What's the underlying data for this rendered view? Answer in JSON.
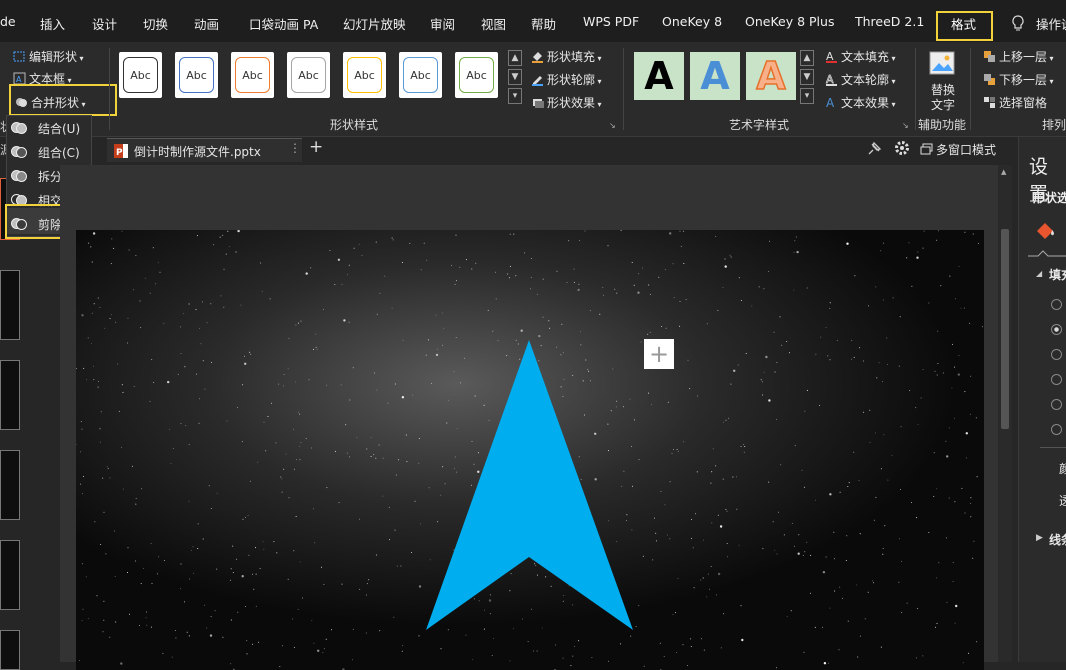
{
  "menu": {
    "items": [
      "de",
      "插入",
      "设计",
      "切换",
      "动画",
      "口袋动画 PA",
      "幻灯片放映",
      "审阅",
      "视图",
      "帮助",
      "WPS PDF",
      "OneKey 8",
      "OneKey 8 Plus",
      "ThreeD 2.1",
      "格式",
      "操作说"
    ]
  },
  "ribbon": {
    "edit_shape": "编辑形状",
    "text_box": "文本框",
    "merge_shapes": "合并形状",
    "style_label": "Abc",
    "shape_fill": "形状填充",
    "shape_outline": "形状轮廓",
    "shape_effect": "形状效果",
    "shape_styles_group": "形状样式",
    "art_letter": "A",
    "text_fill": "文本填充",
    "text_outline": "文本轮廓",
    "text_effect": "文本效果",
    "art_group": "艺术字样式",
    "replace_text_1": "替换",
    "replace_text_2": "文字",
    "aux_group": "辅助功能",
    "bring_forward": "上移一层",
    "send_backward": "下移一层",
    "selection_pane": "选择窗格",
    "arrange_group": "排列",
    "left_stub_1": "状",
    "left_stub_2": "源"
  },
  "dropdown": {
    "items": [
      "结合(U)",
      "组合(C)",
      "拆分(F)",
      "相交(I)",
      "剪除(S)"
    ]
  },
  "tabbar": {
    "file_name": "倒计时制作源文件.pptx",
    "more": "⋮",
    "add": "+",
    "multi_window": "多窗口模式"
  },
  "right_pane": {
    "title": "设置",
    "tab_label": "形状选",
    "fill_label": "填充",
    "line_label": "线条",
    "label_a": "颜",
    "label_b": "透"
  },
  "slide": {
    "plus": "+"
  },
  "colors": {
    "highlight": "#f2d23a",
    "arrow": "#00aeef",
    "menu_bg": "#1e1e1e",
    "ribbon_bg": "#2b2b2b"
  }
}
